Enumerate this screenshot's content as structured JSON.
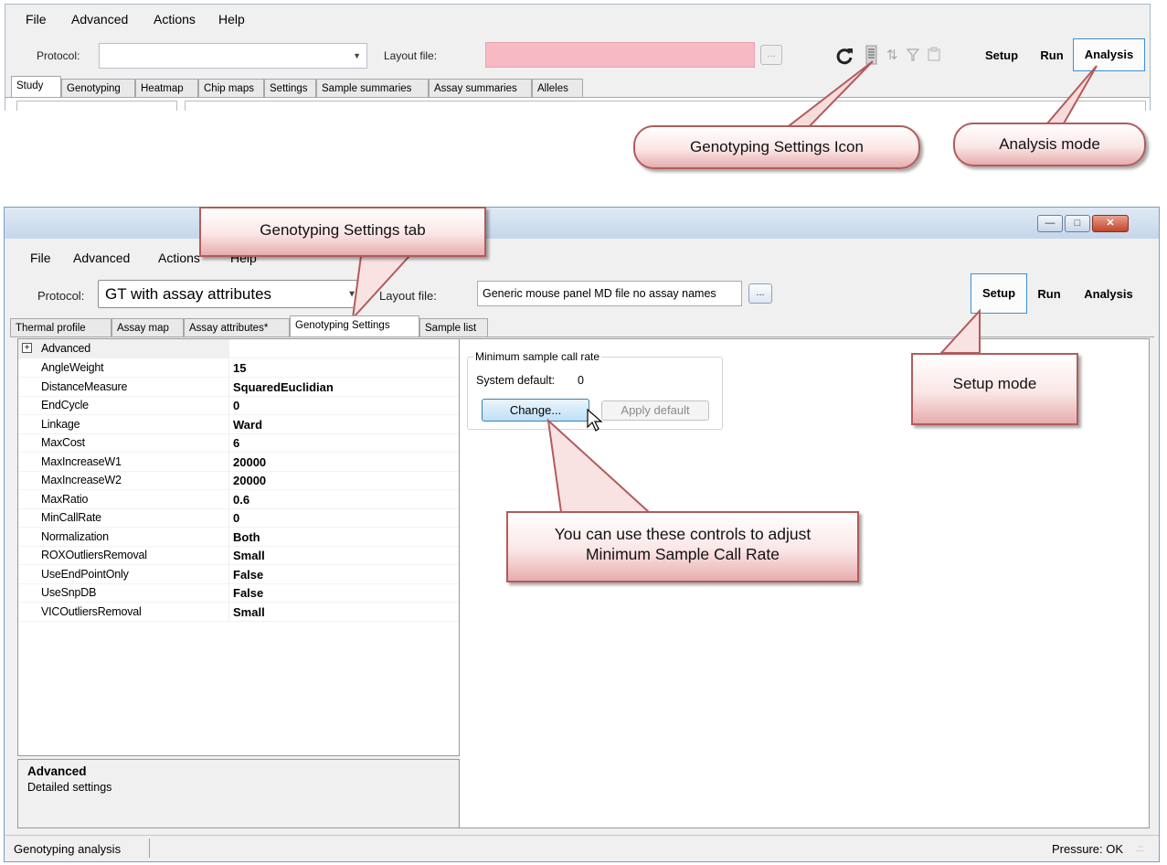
{
  "top": {
    "menu": [
      "File",
      "Advanced",
      "Actions",
      "Help"
    ],
    "protocol_label": "Protocol:",
    "protocol_value": "",
    "layout_label": "Layout file:",
    "layout_value": "",
    "browse_label": "...",
    "modes": {
      "setup": "Setup",
      "run": "Run",
      "analysis": "Analysis"
    },
    "active_mode": "Analysis",
    "tabs": [
      "Study",
      "Genotyping",
      "Heatmap",
      "Chip maps",
      "Settings",
      "Sample summaries",
      "Assay summaries",
      "Alleles"
    ],
    "active_tab": "Study",
    "icons": [
      "refresh-icon",
      "genotyping-settings-icon",
      "sort-icon",
      "filter-icon",
      "clipboard-icon"
    ]
  },
  "callouts": {
    "genotyping_settings_icon": "Genotyping Settings Icon",
    "analysis_mode": "Analysis mode",
    "genotyping_settings_tab": "Genotyping Settings tab",
    "setup_mode": "Setup mode",
    "min_call_rate_line1": "You can use these controls to adjust",
    "min_call_rate_line2": "Minimum Sample Call Rate"
  },
  "main": {
    "menu": [
      "File",
      "Advanced",
      "Actions",
      "Help"
    ],
    "protocol_label": "Protocol:",
    "protocol_value": "GT with assay attributes",
    "layout_label": "Layout file:",
    "layout_value": "Generic mouse panel MD file no assay names",
    "browse_label": "...",
    "modes": {
      "setup": "Setup",
      "run": "Run",
      "analysis": "Analysis"
    },
    "active_mode": "Setup",
    "tabs": [
      "Thermal profile",
      "Assay map",
      "Assay attributes*",
      "Genotyping Settings",
      "Sample list"
    ],
    "active_tab": "Genotyping Settings",
    "properties": {
      "group": "Advanced",
      "rows": [
        {
          "name": "AngleWeight",
          "value": "15"
        },
        {
          "name": "DistanceMeasure",
          "value": "SquaredEuclidian"
        },
        {
          "name": "EndCycle",
          "value": "0"
        },
        {
          "name": "Linkage",
          "value": "Ward"
        },
        {
          "name": "MaxCost",
          "value": "6"
        },
        {
          "name": "MaxIncreaseW1",
          "value": "20000"
        },
        {
          "name": "MaxIncreaseW2",
          "value": "20000"
        },
        {
          "name": "MaxRatio",
          "value": "0.6"
        },
        {
          "name": "MinCallRate",
          "value": "0"
        },
        {
          "name": "Normalization",
          "value": "Both"
        },
        {
          "name": "ROXOutliersRemoval",
          "value": "Small"
        },
        {
          "name": "UseEndPointOnly",
          "value": "False"
        },
        {
          "name": "UseSnpDB",
          "value": "False"
        },
        {
          "name": "VICOutliersRemoval",
          "value": "Small"
        }
      ]
    },
    "description": {
      "title": "Advanced",
      "text": "Detailed settings"
    },
    "call_rate": {
      "group_title": "Minimum sample call rate",
      "system_default_label": "System default:",
      "system_default_value": "0",
      "change_label": "Change...",
      "apply_default_label": "Apply default"
    },
    "status": {
      "left": "Genotyping analysis",
      "right": "Pressure: OK"
    },
    "window_buttons": {
      "minimize": "—",
      "maximize": "□",
      "close": "✕"
    }
  }
}
